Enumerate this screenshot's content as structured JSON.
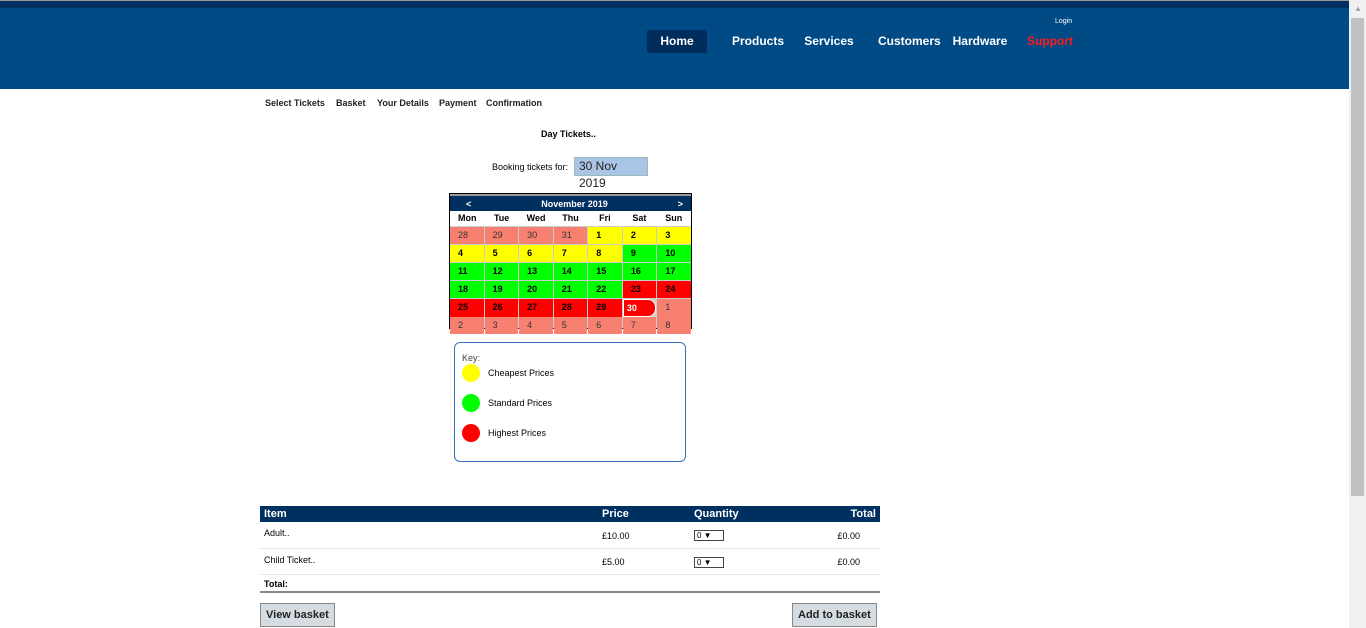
{
  "header": {
    "login": "Login",
    "nav": [
      "Home",
      "Products",
      "Services",
      "Customers",
      "Hardware",
      "Support"
    ]
  },
  "steps": [
    "Select Tickets",
    "Basket",
    "Your Details",
    "Payment",
    "Confirmation"
  ],
  "title": "Day Tickets..",
  "booking": {
    "label": "Booking tickets for:",
    "value": "30 Nov 2019"
  },
  "calendar": {
    "prev": "<",
    "next": ">",
    "month": "November 2019",
    "days": [
      "Mon",
      "Tue",
      "Wed",
      "Thu",
      "Fri",
      "Sat",
      "Sun"
    ],
    "weeks": [
      [
        [
          "28",
          "other"
        ],
        [
          "29",
          "other"
        ],
        [
          "30",
          "other"
        ],
        [
          "31",
          "other"
        ],
        [
          "1",
          "cheap"
        ],
        [
          "2",
          "cheap"
        ],
        [
          "3",
          "cheap"
        ]
      ],
      [
        [
          "4",
          "cheap"
        ],
        [
          "5",
          "cheap"
        ],
        [
          "6",
          "cheap"
        ],
        [
          "7",
          "cheap"
        ],
        [
          "8",
          "cheap"
        ],
        [
          "9",
          "std"
        ],
        [
          "10",
          "std"
        ]
      ],
      [
        [
          "11",
          "std"
        ],
        [
          "12",
          "std"
        ],
        [
          "13",
          "std"
        ],
        [
          "14",
          "std"
        ],
        [
          "15",
          "std"
        ],
        [
          "16",
          "std"
        ],
        [
          "17",
          "std"
        ]
      ],
      [
        [
          "18",
          "std"
        ],
        [
          "19",
          "std"
        ],
        [
          "20",
          "std"
        ],
        [
          "21",
          "std"
        ],
        [
          "22",
          "std"
        ],
        [
          "23",
          "high"
        ],
        [
          "24",
          "high"
        ]
      ],
      [
        [
          "25",
          "high"
        ],
        [
          "26",
          "high"
        ],
        [
          "27",
          "high"
        ],
        [
          "28",
          "high"
        ],
        [
          "29",
          "high"
        ],
        [
          "30",
          "sel"
        ],
        [
          "1",
          "other"
        ]
      ],
      [
        [
          "2",
          "other"
        ],
        [
          "3",
          "other"
        ],
        [
          "4",
          "other"
        ],
        [
          "5",
          "other"
        ],
        [
          "6",
          "other"
        ],
        [
          "7",
          "other"
        ],
        [
          "8",
          "other"
        ]
      ]
    ]
  },
  "key": {
    "label": "Key:",
    "items": [
      {
        "label": "Cheapest Prices",
        "color": "#ffff00"
      },
      {
        "label": "Standard Prices",
        "color": "#00ff00"
      },
      {
        "label": "Highest Prices",
        "color": "#ff0000"
      }
    ]
  },
  "table": {
    "headers": [
      "Item",
      "Price",
      "Quantity",
      "Total"
    ],
    "rows": [
      {
        "item": "Adult..",
        "price": "£10.00",
        "qty": "0",
        "total": "£0.00"
      },
      {
        "item": "Child Ticket..",
        "price": "£5.00",
        "qty": "0",
        "total": "£0.00"
      }
    ],
    "total_label": "Total:"
  },
  "buttons": {
    "view": "View basket",
    "add": "Add to basket"
  }
}
